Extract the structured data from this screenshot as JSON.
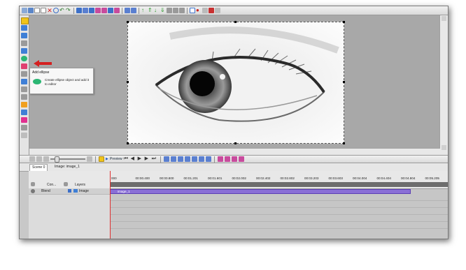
{
  "tooltip": {
    "title": "Add ellipse",
    "description": "Create ellipse object and add it to editor"
  },
  "timeline_toolbar": {
    "preview_label": "Preview"
  },
  "tabs": {
    "scene_tab": "Scene 0",
    "breadcrumb": "Image: image_1"
  },
  "layers_panel": {
    "columns": [
      "Con...",
      "Layers"
    ],
    "track": {
      "blend": "Blend",
      "name": "Image"
    }
  },
  "ruler": {
    "ticks": [
      "000",
      "00:00.400",
      "00:00.800",
      "00:01.201",
      "00:01.601",
      "00:02.002",
      "00:02.402",
      "00:02.802",
      "00:03.203",
      "00:03.603",
      "00:04.004",
      "00:04.404",
      "00:04.804",
      "00:05.205"
    ]
  },
  "clip": {
    "label": "image_1"
  },
  "colors": {
    "ellipse_icon": "#2bb673",
    "clip": "#8a6fd6",
    "playhead": "#e03030",
    "callout_arrow": "#d42020"
  }
}
